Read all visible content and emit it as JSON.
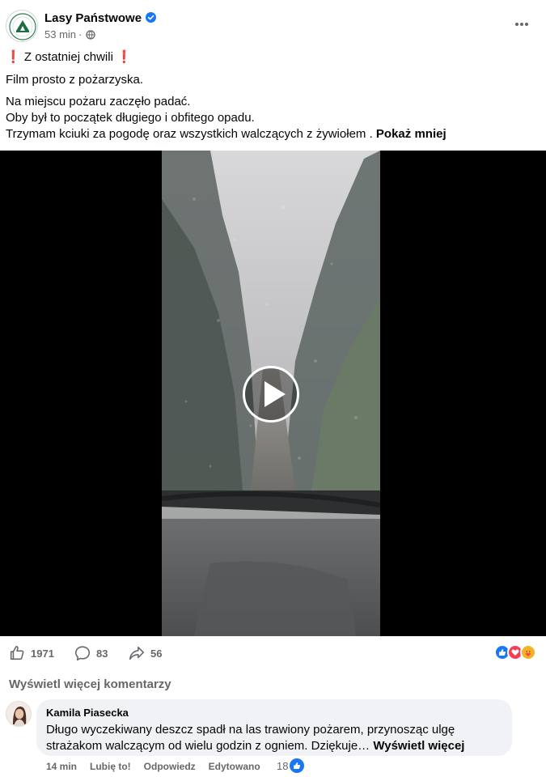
{
  "post": {
    "page_name": "Lasy Państwowe",
    "time": "53 min",
    "separator": "·",
    "privacy_icon": "globe-icon",
    "verified_icon": "verified-badge-icon",
    "menu_icon": "more-options-icon",
    "line1_mark": "❗",
    "line1_text": "Z ostatniej chwili",
    "line2": "Film prosto z pożarzyska.",
    "line3": "Na miejscu pożaru zaczęło padać.",
    "line4": "Oby był to początek długiego i obfitego opadu.",
    "line5": "Trzymam kciuki za pogodę oraz wszystkich walczących z żywiołem .",
    "show_less": "Pokaż mniej"
  },
  "video": {
    "play_icon": "play-icon"
  },
  "stats": {
    "likes": "1971",
    "comments": "83",
    "shares": "56",
    "reactions": [
      "like",
      "love",
      "care"
    ]
  },
  "comments": {
    "view_more": "Wyświetl więcej komentarzy",
    "items": [
      {
        "author": "Kamila Piasecka",
        "text": "Długo wyczekiwany deszcz spadł na las trawiony pożarem, przynosząc ulgę strażakom walczącym od wielu godzin z ogniem. Dziękuje…",
        "see_more": "Wyświetl więcej",
        "time": "14 min",
        "like_action": "Lubię to!",
        "reply_action": "Odpowiedz",
        "edited": "Edytowano",
        "like_count": "18"
      }
    ]
  },
  "colors": {
    "brand_blue": "#1877f2",
    "secondary_text": "#65676b",
    "comment_bg": "#f0f2f5",
    "love_red": "#f33e58"
  }
}
